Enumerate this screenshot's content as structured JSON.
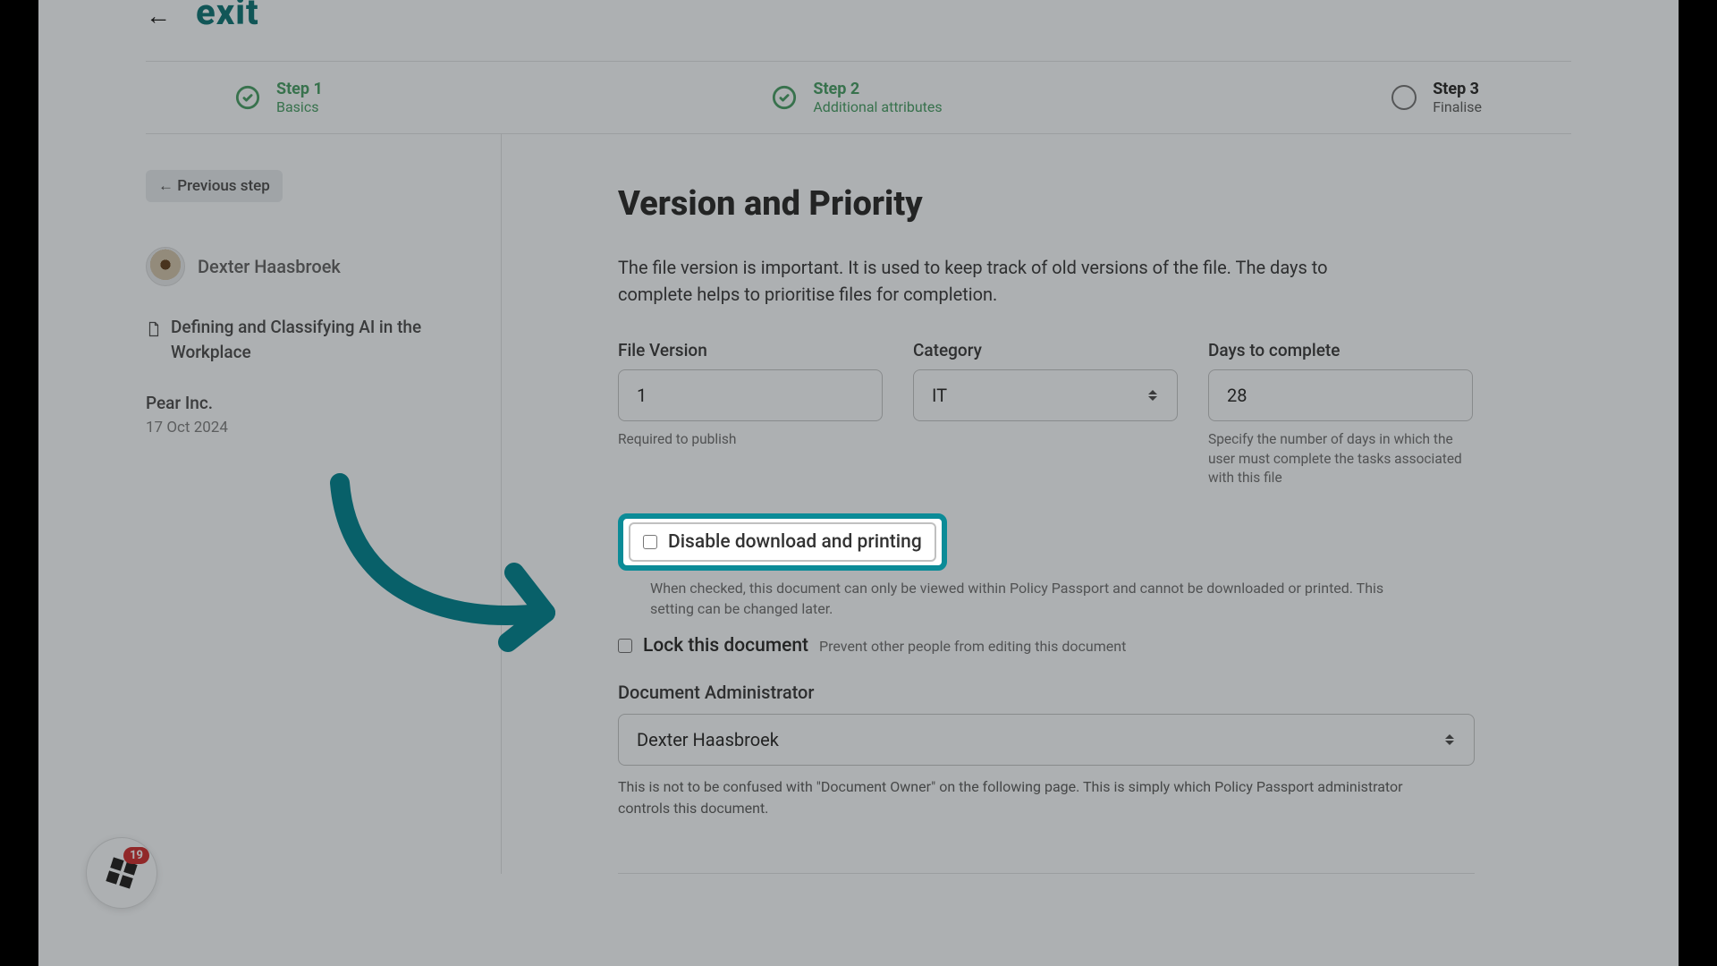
{
  "brand": {
    "back_arrow": "←",
    "name": "exit"
  },
  "steps": [
    {
      "title": "Step 1",
      "sub": "Basics",
      "status": "done"
    },
    {
      "title": "Step 2",
      "sub": "Additional attributes",
      "status": "done"
    },
    {
      "title": "Step 3",
      "sub": "Finalise",
      "status": "pending"
    }
  ],
  "sidebar": {
    "prev_label": "←  Previous step",
    "user_name": "Dexter Haasbroek",
    "doc_title": "Defining and Classifying AI in the Workplace",
    "org_name": "Pear Inc.",
    "date": "17 Oct 2024"
  },
  "page": {
    "title": "Version and Priority",
    "desc": "The file version is important. It is used to keep track of old versions of the file. The days to complete helps to prioritise files for completion."
  },
  "fields": {
    "file_version": {
      "label": "File Version",
      "value": "1",
      "hint": "Required to publish"
    },
    "category": {
      "label": "Category",
      "value": "IT"
    },
    "days": {
      "label": "Days to complete",
      "value": "28",
      "hint": "Specify the number of days in which the user must complete the tasks associated with this file"
    }
  },
  "disable_dl": {
    "label": "Disable download and printing",
    "desc": "When checked, this document can only be viewed within Policy Passport and cannot be downloaded or printed. This setting can be changed later."
  },
  "lock": {
    "label": "Lock this document",
    "hint": "Prevent other people from editing this document"
  },
  "admin": {
    "label": "Document Administrator",
    "value": "Dexter Haasbroek",
    "hint": "This is not to be confused with \"Document Owner\" on the following page. This is simply which Policy Passport administrator controls this document."
  },
  "badge": {
    "count": "19"
  },
  "colors": {
    "accent": "#0b8b97",
    "step_done": "#52a56e"
  }
}
